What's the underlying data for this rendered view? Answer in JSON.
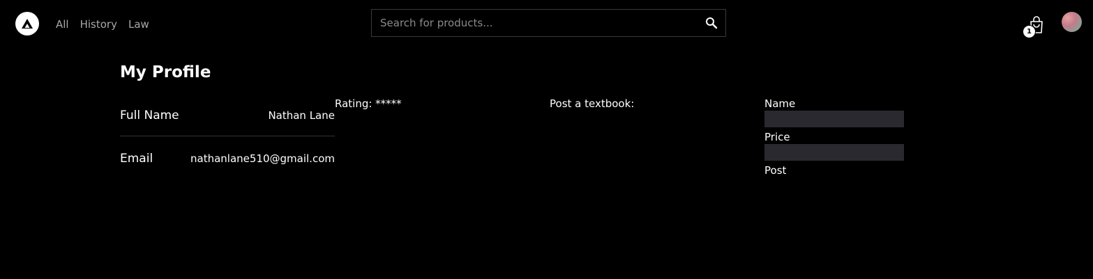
{
  "header": {
    "nav": [
      "All",
      "History",
      "Law"
    ],
    "search_placeholder": "Search for products...",
    "cart_count": "1",
    "icons": {
      "logo": "triangle-logo-icon",
      "search": "search-icon",
      "cart": "shopping-bag-icon"
    }
  },
  "profile": {
    "title": "My Profile",
    "full_name_label": "Full Name",
    "full_name_value": "Nathan Lane",
    "email_label": "Email",
    "email_value": "nathanlane510@gmail.com",
    "rating": "Rating: *****"
  },
  "post_form": {
    "title": "Post a textbook:",
    "name_label": "Name",
    "name_value": "",
    "price_label": "Price",
    "price_value": "",
    "submit_label": "Post"
  }
}
